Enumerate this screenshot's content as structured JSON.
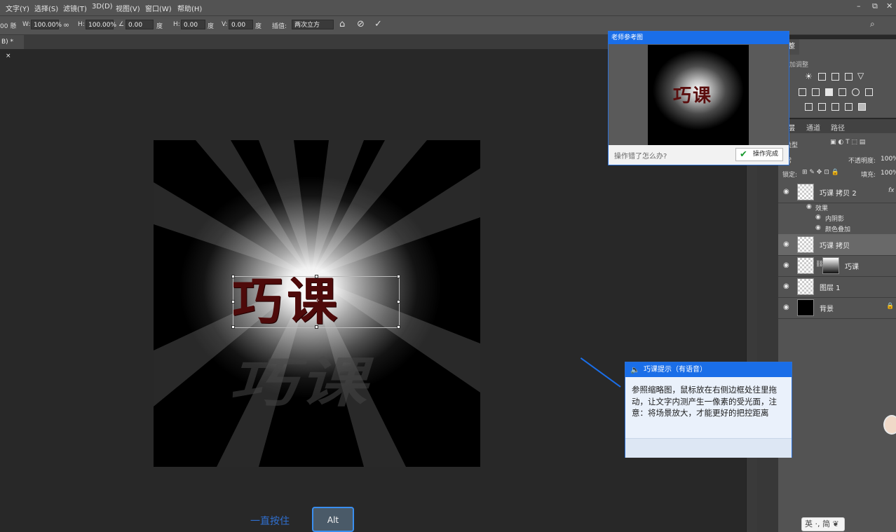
{
  "menu": [
    "文字(Y)",
    "选择(S)",
    "滤镜(T)",
    "3D(D)",
    "视图(V)",
    "窗口(W)",
    "帮助(H)"
  ],
  "window_controls": {
    "minimize": "–",
    "restore": "⧉",
    "close": "✕"
  },
  "options": {
    "ref_icon": "00 懸",
    "w_label": "W:",
    "w_value": "100.00%",
    "h_label": "H:",
    "h_value": "100.00%",
    "angle_value": "0.00",
    "deg1": "度",
    "hskew_label": "H:",
    "hskew_value": "0.00",
    "deg2": "度",
    "vskew_label": "V:",
    "vskew_value": "0.00",
    "deg3": "度",
    "interp_label": "插值:",
    "interp_value": "两次立方"
  },
  "doc_tab": {
    "label": "B) *",
    "close": "×"
  },
  "canvas": {
    "main_text": "巧课",
    "shadow_text": "巧课"
  },
  "reference": {
    "title": "老师参考图",
    "image_text": "巧课",
    "question": "操作错了怎么办?",
    "done_label": "操作完成"
  },
  "tip": {
    "title": "巧课提示（有语音）",
    "body": "参照缩略图，鼠标放在右侧边框处往里拖动，让文字内测产生一像素的受光面，注意：将场景放大，才能更好的把控距离"
  },
  "hint": {
    "hold_text": "一直按住",
    "key": "Alt"
  },
  "adjust_panel": {
    "tab": "整",
    "add_label": "加调整"
  },
  "layers_panel": {
    "tabs": [
      "层",
      "通道",
      "路径"
    ],
    "kind_filter": "类型",
    "blend_mode": "常",
    "opacity_label": "不透明度:",
    "opacity_value": "100%",
    "lock_label": "锁定:",
    "fill_label": "填充:",
    "fill_value": "100%",
    "effects_label": "效果",
    "effect_1": "内阴影",
    "effect_2": "颜色叠加",
    "layers": [
      {
        "name": "巧课 拷贝 2",
        "fx": "fx"
      },
      {
        "name": "巧课 拷贝"
      },
      {
        "name": "巧课"
      },
      {
        "name": "图层 1"
      },
      {
        "name": "背景"
      }
    ]
  },
  "ime": "英 ·, 简 ❦",
  "colors": {
    "accent": "#1a6ee8",
    "text_red": "#4e0a0a",
    "panel": "#535353",
    "canvas_bg": "#282828"
  }
}
